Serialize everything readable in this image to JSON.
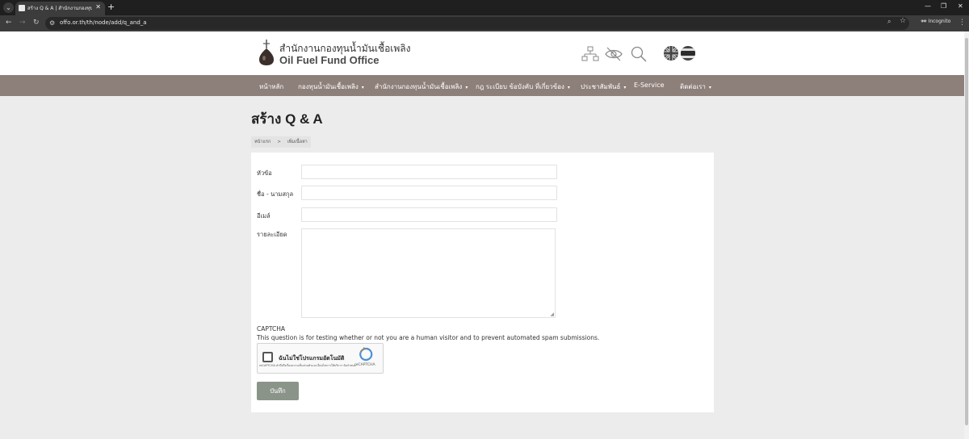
{
  "browser": {
    "tab_title": "สร้าง Q & A | สำนักงานกองทุนน้ำมั...",
    "url": "offo.or.th/th/node/add/q_and_a",
    "incognito_label": "Incognito"
  },
  "header": {
    "logo_th": "สำนักงานกองทุนน้ำมันเชื้อเพลิง",
    "logo_en": "Oil Fuel Fund Office"
  },
  "nav": {
    "items": [
      {
        "label": "หน้าหลัก",
        "has_caret": false
      },
      {
        "label": "กองทุนน้ำมันเชื้อเพลิง",
        "has_caret": true
      },
      {
        "label": "สำนักงานกองทุนน้ำมันเชื้อเพลิง",
        "has_caret": true
      },
      {
        "label": "กฎ ระเบียบ ข้อบังคับ ที่เกี่ยวข้อง",
        "has_caret": true
      },
      {
        "label": "ประชาสัมพันธ์",
        "has_caret": true
      },
      {
        "label": "E-Service",
        "has_caret": false
      },
      {
        "label": "ติดต่อเรา",
        "has_caret": true
      }
    ]
  },
  "page": {
    "title": "สร้าง Q & A",
    "breadcrumb": {
      "home": "หน้าแรก",
      "separator": ">",
      "current": "เพิ่มเนื้อหา"
    }
  },
  "form": {
    "subject_label": "หัวข้อ",
    "name_label": "ชื่อ - นามสกุล",
    "email_label": "อีเมล์",
    "details_label": "รายละเอียด",
    "captcha_title": "CAPTCHA",
    "captcha_desc": "This question is for testing whether or not you are a human visitor and to prevent automated spam submissions.",
    "recaptcha_label": "ฉันไม่ใช่โปรแกรมอัตโนมัติ",
    "recaptcha_privacy": "reCAPTCHA คำนึงถึงเรื่องความเป็นส่วนตัวและเงื่อนไขการให้บริการ ข้อกำหนด",
    "recaptcha_brand": "reCAPTCHA",
    "save_label": "บันทึก"
  },
  "colors": {
    "nav_bg": "#8d7f7a",
    "save_button": "#8b9489"
  },
  "icons": [
    "sitemap-icon",
    "accessibility-icon",
    "search-icon",
    "uk-flag-icon",
    "thai-flag-icon"
  ]
}
